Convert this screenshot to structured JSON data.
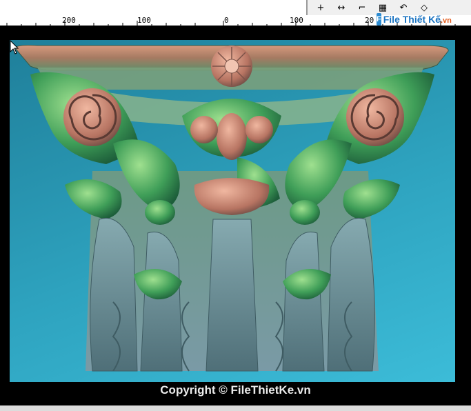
{
  "ruler": {
    "labels": [
      "200",
      "100",
      "0",
      "100",
      "20"
    ]
  },
  "toolbar": {
    "tools": [
      {
        "icon": "crosshair-icon",
        "glyph": "+"
      },
      {
        "icon": "measure-horizontal-icon",
        "glyph": "↔"
      },
      {
        "icon": "align-corner-icon",
        "glyph": "⌐"
      },
      {
        "icon": "grid-table-icon",
        "glyph": "▦"
      },
      {
        "icon": "rotate-icon",
        "glyph": "↶"
      },
      {
        "icon": "mirror-icon",
        "glyph": "◇"
      }
    ]
  },
  "watermark": {
    "brand": "File Thiết Kế",
    "suffix": ".vn",
    "badge": "F"
  },
  "copyright": "Copyright © FileThietKe.vn",
  "colors": {
    "viewport_bg": "#2ea3bf",
    "relief_green": "#4caf5f",
    "relief_pink": "#c8826f",
    "relief_slate": "#7f9fa8"
  }
}
